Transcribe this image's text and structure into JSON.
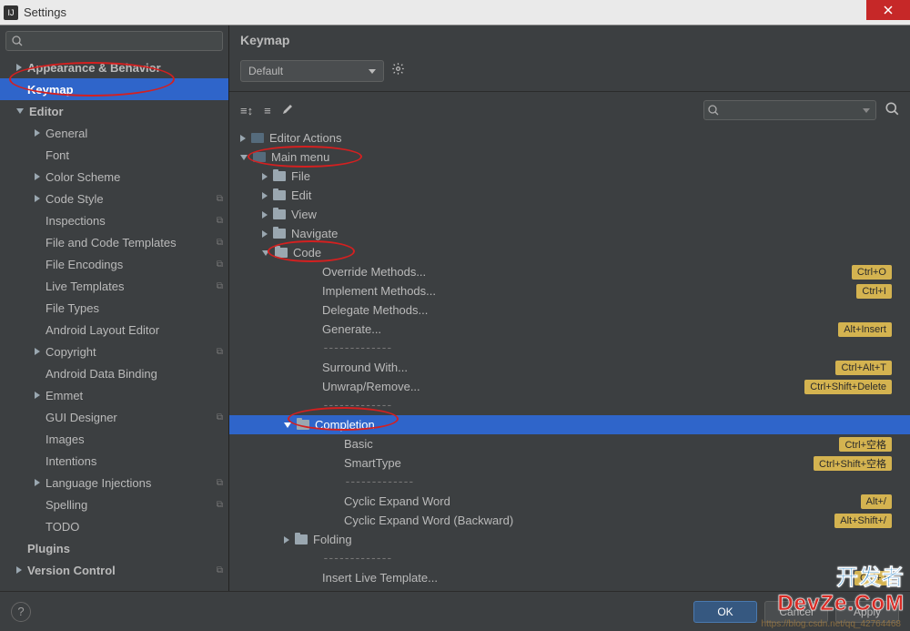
{
  "window": {
    "title": "Settings"
  },
  "sidebar": {
    "search_placeholder": "",
    "items": [
      {
        "label": "Appearance & Behavior",
        "depth": 0,
        "arrow": "right",
        "selected": false,
        "badge": false
      },
      {
        "label": "Keymap",
        "depth": 0,
        "arrow": "",
        "selected": true,
        "badge": false
      },
      {
        "label": "Editor",
        "depth": 0,
        "arrow": "down",
        "selected": false,
        "badge": false
      },
      {
        "label": "General",
        "depth": 1,
        "arrow": "right",
        "selected": false,
        "badge": false
      },
      {
        "label": "Font",
        "depth": 1,
        "arrow": "",
        "selected": false,
        "badge": false
      },
      {
        "label": "Color Scheme",
        "depth": 1,
        "arrow": "right",
        "selected": false,
        "badge": false
      },
      {
        "label": "Code Style",
        "depth": 1,
        "arrow": "right",
        "selected": false,
        "badge": true
      },
      {
        "label": "Inspections",
        "depth": 1,
        "arrow": "",
        "selected": false,
        "badge": true
      },
      {
        "label": "File and Code Templates",
        "depth": 1,
        "arrow": "",
        "selected": false,
        "badge": true
      },
      {
        "label": "File Encodings",
        "depth": 1,
        "arrow": "",
        "selected": false,
        "badge": true
      },
      {
        "label": "Live Templates",
        "depth": 1,
        "arrow": "",
        "selected": false,
        "badge": true
      },
      {
        "label": "File Types",
        "depth": 1,
        "arrow": "",
        "selected": false,
        "badge": false
      },
      {
        "label": "Android Layout Editor",
        "depth": 1,
        "arrow": "",
        "selected": false,
        "badge": false
      },
      {
        "label": "Copyright",
        "depth": 1,
        "arrow": "right",
        "selected": false,
        "badge": true
      },
      {
        "label": "Android Data Binding",
        "depth": 1,
        "arrow": "",
        "selected": false,
        "badge": false
      },
      {
        "label": "Emmet",
        "depth": 1,
        "arrow": "right",
        "selected": false,
        "badge": false
      },
      {
        "label": "GUI Designer",
        "depth": 1,
        "arrow": "",
        "selected": false,
        "badge": true
      },
      {
        "label": "Images",
        "depth": 1,
        "arrow": "",
        "selected": false,
        "badge": false
      },
      {
        "label": "Intentions",
        "depth": 1,
        "arrow": "",
        "selected": false,
        "badge": false
      },
      {
        "label": "Language Injections",
        "depth": 1,
        "arrow": "right",
        "selected": false,
        "badge": true
      },
      {
        "label": "Spelling",
        "depth": 1,
        "arrow": "",
        "selected": false,
        "badge": true
      },
      {
        "label": "TODO",
        "depth": 1,
        "arrow": "",
        "selected": false,
        "badge": false
      },
      {
        "label": "Plugins",
        "depth": 0,
        "arrow": "",
        "selected": false,
        "badge": false
      },
      {
        "label": "Version Control",
        "depth": 0,
        "arrow": "right",
        "selected": false,
        "badge": true
      }
    ]
  },
  "content": {
    "title": "Keymap",
    "keymap_dropdown": "Default",
    "tree": [
      {
        "depth": 0,
        "arrow": "right",
        "icon": "special",
        "label": "Editor Actions",
        "shortcut": "",
        "selected": false
      },
      {
        "depth": 0,
        "arrow": "down",
        "icon": "special",
        "label": "Main menu",
        "shortcut": "",
        "selected": false
      },
      {
        "depth": 1,
        "arrow": "right",
        "icon": "folder",
        "label": "File",
        "shortcut": "",
        "selected": false
      },
      {
        "depth": 1,
        "arrow": "right",
        "icon": "folder",
        "label": "Edit",
        "shortcut": "",
        "selected": false
      },
      {
        "depth": 1,
        "arrow": "right",
        "icon": "folder",
        "label": "View",
        "shortcut": "",
        "selected": false
      },
      {
        "depth": 1,
        "arrow": "right",
        "icon": "folder",
        "label": "Navigate",
        "shortcut": "",
        "selected": false
      },
      {
        "depth": 1,
        "arrow": "down",
        "icon": "folder",
        "label": "Code",
        "shortcut": "",
        "selected": false
      },
      {
        "depth": 2,
        "arrow": "",
        "icon": "",
        "label": "Override Methods...",
        "shortcut": "Ctrl+O",
        "selected": false
      },
      {
        "depth": 2,
        "arrow": "",
        "icon": "",
        "label": "Implement Methods...",
        "shortcut": "Ctrl+I",
        "selected": false
      },
      {
        "depth": 2,
        "arrow": "",
        "icon": "",
        "label": "Delegate Methods...",
        "shortcut": "",
        "selected": false
      },
      {
        "depth": 2,
        "arrow": "",
        "icon": "",
        "label": "Generate...",
        "shortcut": "Alt+Insert",
        "selected": false
      },
      {
        "depth": 2,
        "arrow": "",
        "icon": "",
        "label": "-------------",
        "dashes": true,
        "shortcut": "",
        "selected": false
      },
      {
        "depth": 2,
        "arrow": "",
        "icon": "",
        "label": "Surround With...",
        "shortcut": "Ctrl+Alt+T",
        "selected": false
      },
      {
        "depth": 2,
        "arrow": "",
        "icon": "",
        "label": "Unwrap/Remove...",
        "shortcut": "Ctrl+Shift+Delete",
        "selected": false
      },
      {
        "depth": 2,
        "arrow": "",
        "icon": "",
        "label": "-------------",
        "dashes": true,
        "shortcut": "",
        "selected": false
      },
      {
        "depth": 2,
        "arrow": "down",
        "icon": "folder",
        "label": "Completion",
        "shortcut": "",
        "selected": true
      },
      {
        "depth": 3,
        "arrow": "",
        "icon": "",
        "label": "Basic",
        "shortcut": "Ctrl+空格",
        "selected": false
      },
      {
        "depth": 3,
        "arrow": "",
        "icon": "",
        "label": "SmartType",
        "shortcut": "Ctrl+Shift+空格",
        "selected": false
      },
      {
        "depth": 3,
        "arrow": "",
        "icon": "",
        "label": "-------------",
        "dashes": true,
        "shortcut": "",
        "selected": false
      },
      {
        "depth": 3,
        "arrow": "",
        "icon": "",
        "label": "Cyclic Expand Word",
        "shortcut": "Alt+/",
        "selected": false
      },
      {
        "depth": 3,
        "arrow": "",
        "icon": "",
        "label": "Cyclic Expand Word (Backward)",
        "shortcut": "Alt+Shift+/",
        "selected": false
      },
      {
        "depth": 2,
        "arrow": "right",
        "icon": "folder",
        "label": "Folding",
        "shortcut": "",
        "selected": false
      },
      {
        "depth": 2,
        "arrow": "",
        "icon": "",
        "label": "-------------",
        "dashes": true,
        "shortcut": "",
        "selected": false
      },
      {
        "depth": 2,
        "arrow": "",
        "icon": "",
        "label": "Insert Live Template...",
        "shortcut": "Ctrl+J",
        "selected": false
      }
    ]
  },
  "footer": {
    "ok": "OK",
    "cancel": "Cancel",
    "apply": "Apply",
    "watermark": "https://blog.csdn.net/qq_42764468"
  },
  "brand": {
    "line1": "开发者",
    "line2": "DevZe.CoM"
  }
}
